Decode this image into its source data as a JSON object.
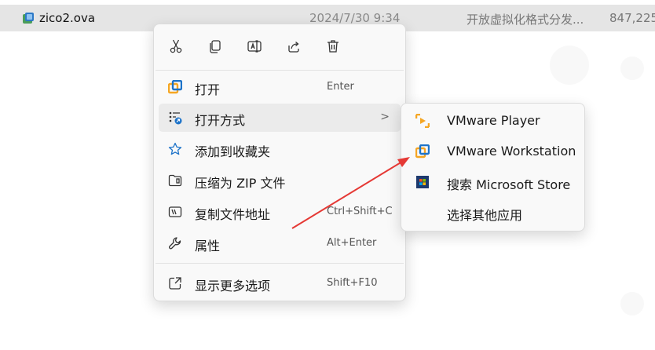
{
  "file": {
    "name": "zico2.ova",
    "date": "2024/7/30 9:34",
    "type": "开放虚拟化格式分发...",
    "size": "847,225"
  },
  "quick_actions": [
    {
      "icon": "cut-icon"
    },
    {
      "icon": "copy-icon"
    },
    {
      "icon": "rename-icon"
    },
    {
      "icon": "share-icon"
    },
    {
      "icon": "delete-icon"
    }
  ],
  "menu": {
    "open": {
      "label": "打开",
      "shortcut": "Enter",
      "icon": "vmware-icon"
    },
    "open_with": {
      "label": "打开方式",
      "icon": "open-with-icon",
      "arrow": ">"
    },
    "favorites": {
      "label": "添加到收藏夹",
      "icon": "star-icon"
    },
    "zip": {
      "label": "压缩为 ZIP 文件",
      "icon": "zip-icon"
    },
    "copy_path": {
      "label": "复制文件地址",
      "shortcut": "Ctrl+Shift+C",
      "icon": "copy-path-icon"
    },
    "properties": {
      "label": "属性",
      "shortcut": "Alt+Enter",
      "icon": "wrench-icon"
    },
    "more": {
      "label": "显示更多选项",
      "shortcut": "Shift+F10",
      "icon": "more-options-icon"
    }
  },
  "submenu": {
    "player": {
      "label": "VMware Player",
      "icon": "vmware-player-icon"
    },
    "workstation": {
      "label": "VMware Workstation",
      "icon": "vmware-workstation-icon"
    },
    "store": {
      "label": "搜索 Microsoft Store",
      "icon": "microsoft-store-icon"
    },
    "other": {
      "label": "选择其他应用"
    }
  },
  "colors": {
    "accent_orange": "#f5a623",
    "accent_blue": "#1d73c9",
    "arrow_red": "#e53935"
  }
}
